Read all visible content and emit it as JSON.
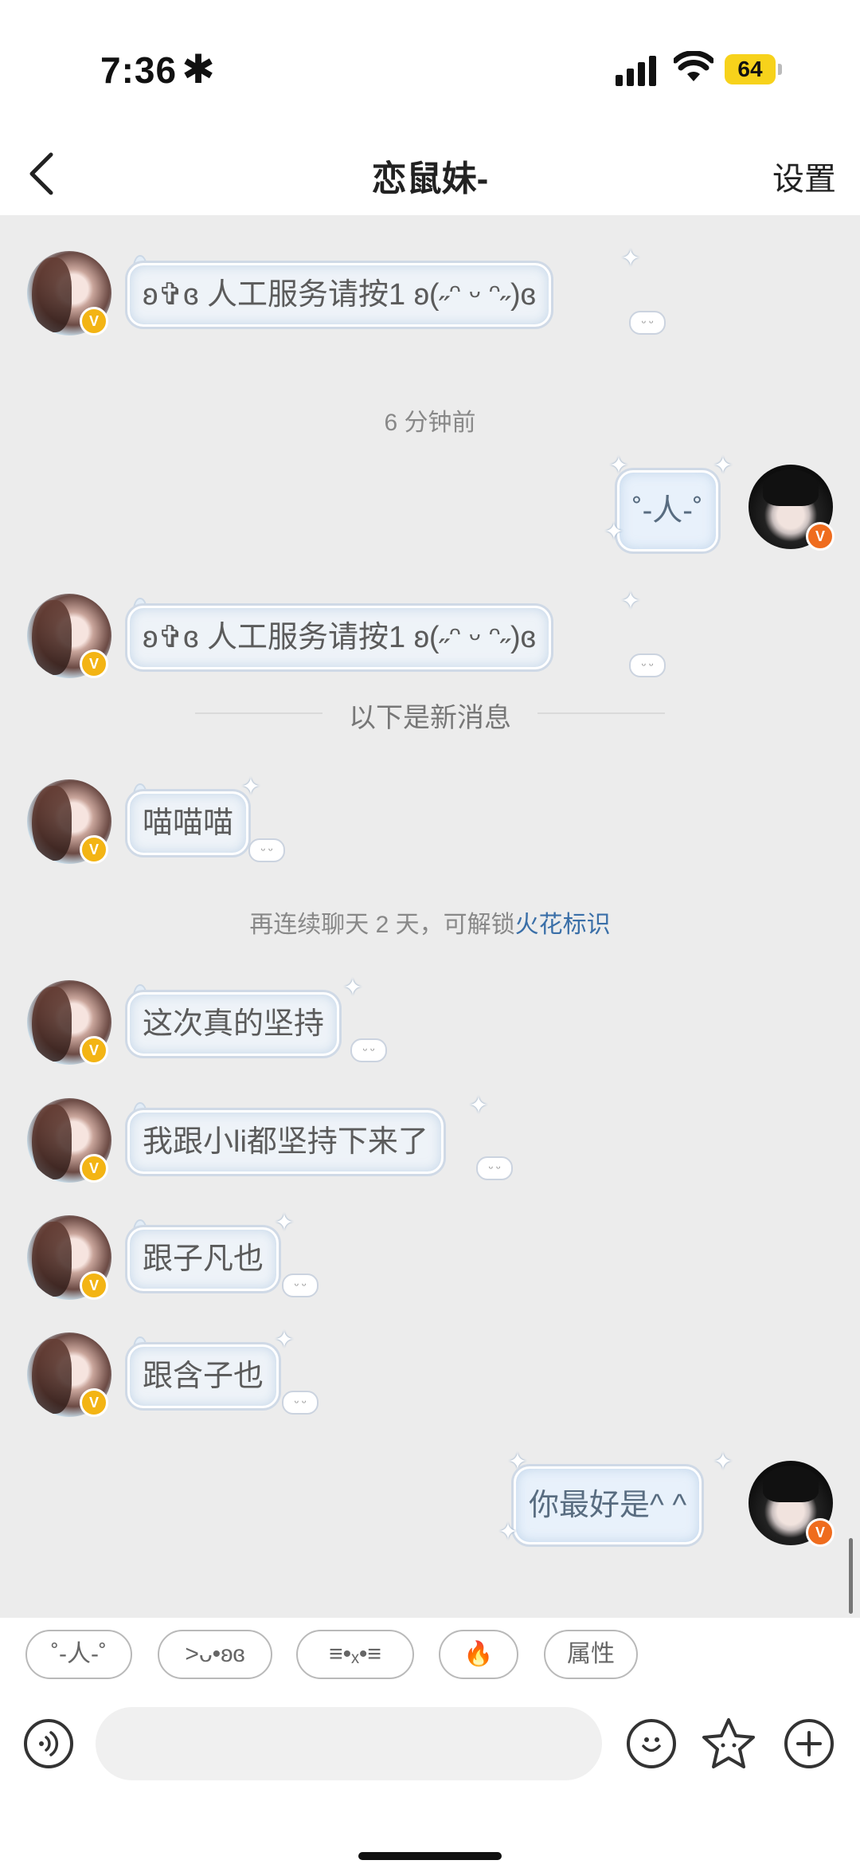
{
  "status_bar": {
    "time": "7:36",
    "time_symbol": "✱",
    "battery": "64"
  },
  "nav": {
    "title": "恋鼠妹-",
    "settings": "设置"
  },
  "colors": {
    "accent_link": "#3a6fa8",
    "badge_gold": "#f3b414",
    "badge_orange": "#ef6c1e",
    "battery": "#f7d21b"
  },
  "messages": [
    {
      "side": "left",
      "text": "ʚ✞ɞ  人工服务请按1  ʚ(˶ᵔ ᵕ ᵔ˶)ɞ",
      "badge": "V"
    },
    {
      "side": "right",
      "text": "˚-人-˚",
      "badge": "V"
    },
    {
      "side": "left",
      "text": "ʚ✞ɞ  人工服务请按1  ʚ(˶ᵔ ᵕ ᵔ˶)ɞ",
      "badge": "V"
    },
    {
      "side": "left",
      "text": "喵喵喵",
      "badge": "V"
    },
    {
      "side": "left",
      "text": "这次真的坚持",
      "badge": "V"
    },
    {
      "side": "left",
      "text": "我跟小li都坚持下来了",
      "badge": "V"
    },
    {
      "side": "left",
      "text": "跟子凡也",
      "badge": "V"
    },
    {
      "side": "left",
      "text": "跟含子也",
      "badge": "V"
    },
    {
      "side": "right",
      "text": "你最好是^ ^",
      "badge": "V"
    }
  ],
  "system": {
    "timestamp": "6 分钟前",
    "new_messages": "以下是新消息",
    "streak_prefix": "再连续聊天 2 天，可解锁",
    "streak_link": "火花标识"
  },
  "quick_replies": [
    "˚-人-˚",
    ">ᴗ•ʚɞ",
    "≡•ₓ•≡",
    "🔥",
    "属性"
  ],
  "input_bar": {
    "voice_icon": "voice-icon",
    "emoji_icon": "emoji-icon",
    "sticker_icon": "sticker-star-icon",
    "plus_icon": "plus-icon"
  }
}
